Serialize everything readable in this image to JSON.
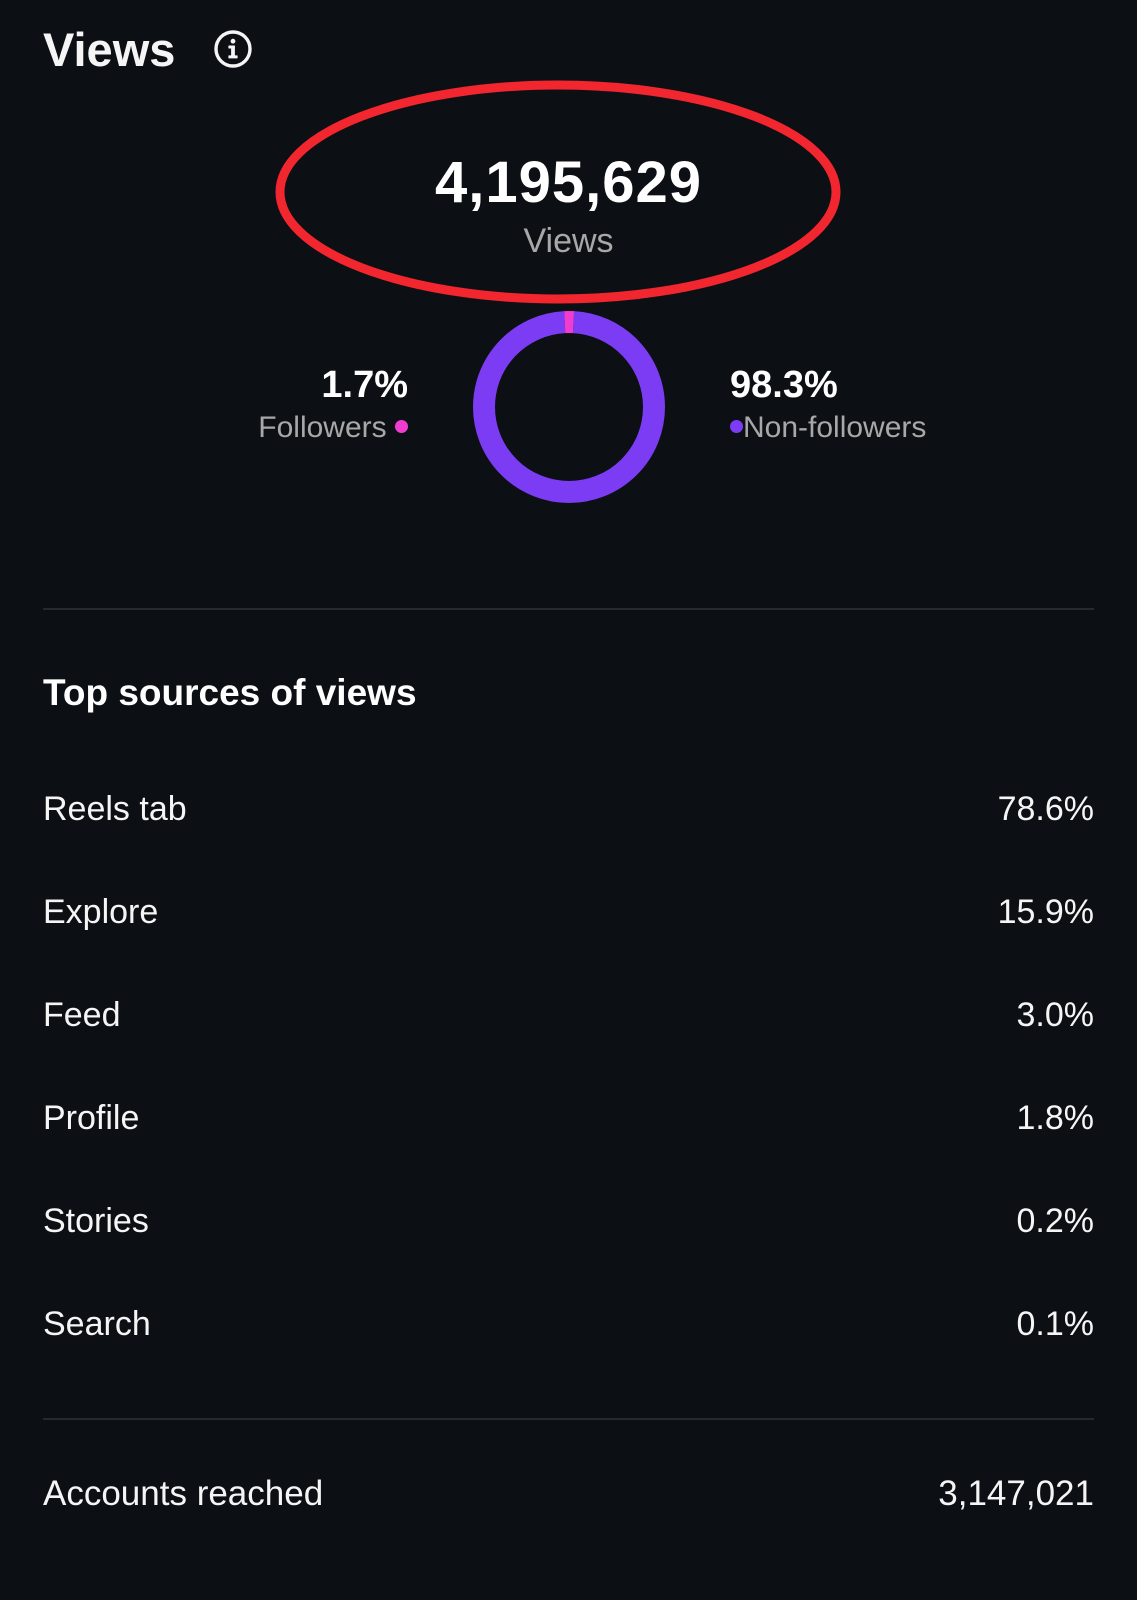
{
  "header": {
    "title": "Views",
    "info_icon": "info-circle-icon"
  },
  "summary": {
    "total": "4,195,629",
    "total_label": "Views"
  },
  "audience": {
    "followers": {
      "percent": "1.7%",
      "label": "Followers",
      "value": 1.7,
      "color": "#f03ccf"
    },
    "non_followers": {
      "percent": "98.3%",
      "label": "Non-followers",
      "value": 98.3,
      "color": "#7c3cf4"
    }
  },
  "annotation": {
    "color": "#f2262e",
    "shape": "ellipse"
  },
  "sources": {
    "title": "Top sources of views",
    "items": [
      {
        "label": "Reels tab",
        "value": "78.6%"
      },
      {
        "label": "Explore",
        "value": "15.9%"
      },
      {
        "label": "Feed",
        "value": "3.0%"
      },
      {
        "label": "Profile",
        "value": "1.8%"
      },
      {
        "label": "Stories",
        "value": "0.2%"
      },
      {
        "label": "Search",
        "value": "0.1%"
      }
    ]
  },
  "reach": {
    "label": "Accounts reached",
    "value": "3,147,021"
  },
  "theme": {
    "background": "#0c1014",
    "divider": "#262a30",
    "muted_text": "#a8a8a8"
  }
}
